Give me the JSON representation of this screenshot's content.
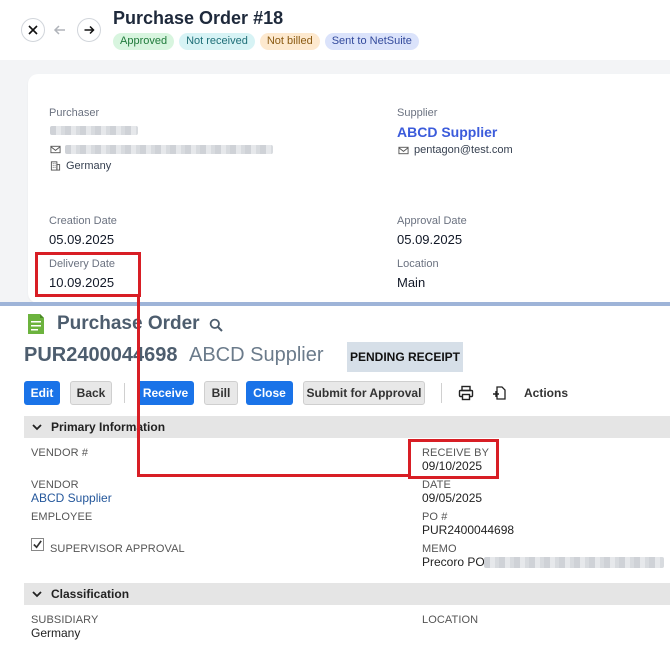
{
  "header": {
    "title": "Purchase Order #18",
    "badges": [
      {
        "label": "Approved",
        "bg": "#d8f5df",
        "color": "#1f7a3a"
      },
      {
        "label": "Not received",
        "bg": "#d7f3f5",
        "color": "#1f6f78"
      },
      {
        "label": "Not billed",
        "bg": "#fde9cf",
        "color": "#8a5a12"
      },
      {
        "label": "Sent to NetSuite",
        "bg": "#dbe3fb",
        "color": "#334a9c"
      }
    ]
  },
  "precoro": {
    "purchaser_label": "Purchaser",
    "purchaser_country": "Germany",
    "supplier_label": "Supplier",
    "supplier_name": "ABCD Supplier",
    "supplier_email": "pentagon@test.com",
    "creation_date_label": "Creation Date",
    "creation_date": "05.09.2025",
    "approval_date_label": "Approval Date",
    "approval_date": "05.09.2025",
    "delivery_date_label": "Delivery Date",
    "delivery_date": "10.09.2025",
    "location_label": "Location",
    "location": "Main"
  },
  "netsuite": {
    "record_type": "Purchase Order",
    "record_number": "PUR2400044698",
    "vendor_title": "ABCD Supplier",
    "status": "PENDING RECEIPT",
    "buttons": {
      "edit": "Edit",
      "back": "Back",
      "receive": "Receive",
      "bill": "Bill",
      "close": "Close",
      "submit": "Submit for Approval",
      "actions": "Actions"
    },
    "primary_section": "Primary Information",
    "fields": {
      "vendor_no_label": "VENDOR #",
      "receive_by_label": "RECEIVE BY",
      "receive_by": "09/10/2025",
      "vendor_label": "VENDOR",
      "vendor": "ABCD Supplier",
      "date_label": "DATE",
      "date": "09/05/2025",
      "employee_label": "EMPLOYEE",
      "po_no_label": "PO #",
      "po_no": "PUR2400044698",
      "supervisor_label": "SUPERVISOR APPROVAL",
      "memo_label": "MEMO",
      "memo": "Precoro PO#"
    },
    "classification_section": "Classification",
    "subsidiary_label": "SUBSIDIARY",
    "subsidiary": "Germany",
    "location_label": "LOCATION"
  },
  "icons": [
    "close-icon",
    "arrow-left-icon",
    "arrow-right-icon",
    "mail-icon",
    "building-icon",
    "document-icon",
    "search-icon",
    "print-icon",
    "attach-icon",
    "chevron-down-icon",
    "check-icon"
  ],
  "colors": {
    "annotation": "#d81e25",
    "ns_blue": "#1a73e8",
    "supplier_link": "#3b5bdb"
  }
}
